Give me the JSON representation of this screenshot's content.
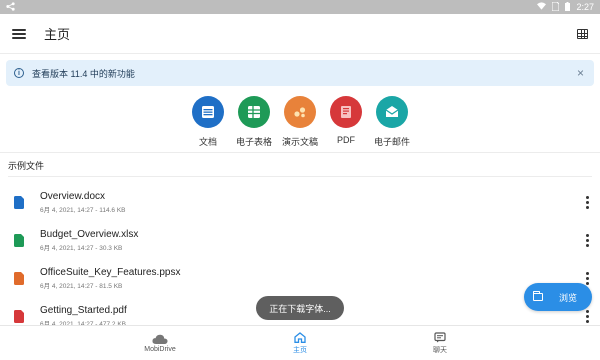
{
  "status_bar": {
    "time": "2:27"
  },
  "app_bar": {
    "title": "主页"
  },
  "banner": {
    "text": "查看版本 11.4 中的新功能",
    "close": "×"
  },
  "categories": [
    {
      "label": "文档",
      "icon": "document-icon",
      "color": "#1f6fc6"
    },
    {
      "label": "电子表格",
      "icon": "spreadsheet-icon",
      "color": "#1e9a57"
    },
    {
      "label": "演示文稿",
      "icon": "presentation-icon",
      "color": "#e8823a"
    },
    {
      "label": "PDF",
      "icon": "pdf-icon",
      "color": "#d6383a"
    },
    {
      "label": "电子邮件",
      "icon": "email-icon",
      "color": "#1aa6a6"
    }
  ],
  "section": {
    "title": "示例文件"
  },
  "files": [
    {
      "name": "Overview.docx",
      "meta": "6月 4, 2021, 14:27 - 114.6 KB",
      "icon": "word-doc-icon",
      "color": "#1f6fc6"
    },
    {
      "name": "Budget_Overview.xlsx",
      "meta": "6月 4, 2021, 14:27 - 30.3 KB",
      "icon": "excel-sheet-icon",
      "color": "#1e9a57"
    },
    {
      "name": "OfficeSuite_Key_Features.ppsx",
      "meta": "6月 4, 2021, 14:27 - 81.5 KB",
      "icon": "powerpoint-icon",
      "color": "#e06b2b"
    },
    {
      "name": "Getting_Started.pdf",
      "meta": "6月 4, 2021, 14:27 - 477.2 KB",
      "icon": "pdf-file-icon",
      "color": "#d6383a"
    }
  ],
  "toast": {
    "text": "正在下载字体..."
  },
  "fab": {
    "label": "浏览"
  },
  "bottom_nav": [
    {
      "label": "MobiDrive",
      "icon": "cloud-icon",
      "active": false
    },
    {
      "label": "主页",
      "icon": "home-icon",
      "active": true
    },
    {
      "label": "聊天",
      "icon": "chat-icon",
      "active": false
    }
  ],
  "colors": {
    "accent": "#2b8ee6",
    "banner_bg": "#e3f0fb"
  }
}
